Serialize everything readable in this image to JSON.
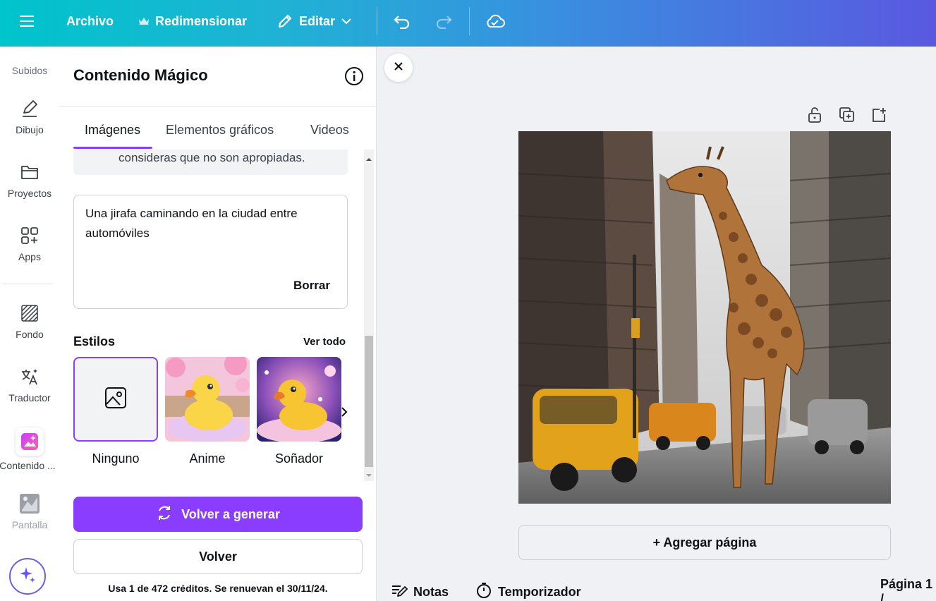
{
  "topbar": {
    "menu_icon": "hamburger-icon",
    "file_label": "Archivo",
    "resize_label": "Redimensionar",
    "resize_icon": "crown-icon",
    "edit_label": "Editar",
    "edit_icon": "pencil-icon",
    "undo_icon": "undo-icon",
    "redo_icon": "redo-icon",
    "save_status_icon": "cloud-check-icon"
  },
  "rail": {
    "items": [
      {
        "label": "Subidos",
        "icon": "upload-icon"
      },
      {
        "label": "Dibujo",
        "icon": "draw-pen-icon"
      },
      {
        "label": "Proyectos",
        "icon": "folder-icon"
      },
      {
        "label": "Apps",
        "icon": "apps-grid-icon"
      },
      {
        "label": "Fondo",
        "icon": "background-stripes-icon"
      },
      {
        "label": "Traductor",
        "icon": "translate-icon"
      },
      {
        "label": "Contenido ...",
        "icon": "magic-media-icon"
      },
      {
        "label": "Pantalla",
        "icon": "screen-icon"
      }
    ],
    "assistant_icon": "sparkle-icon"
  },
  "panel": {
    "title": "Contenido Mágico",
    "tabs": [
      {
        "label": "Imágenes",
        "active": true
      },
      {
        "label": "Elementos gráficos",
        "active": false
      },
      {
        "label": "Videos",
        "active": false
      }
    ],
    "notice_partial": "consideras que no son apropiadas.",
    "prompt": {
      "value": "Una jirafa caminando en la ciudad entre automóviles",
      "clear_label": "Borrar"
    },
    "styles": {
      "title": "Estilos",
      "see_all": "Ver todo",
      "items": [
        {
          "label": "Ninguno",
          "selected": true
        },
        {
          "label": "Anime",
          "selected": false
        },
        {
          "label": "Soñador",
          "selected": false
        }
      ]
    },
    "regenerate_label": "Volver a generar",
    "back_label": "Volver",
    "credits_text": "Usa 1 de 472 créditos. Se renuevan el 30/11/24."
  },
  "canvas": {
    "add_page_label": "+ Agregar página",
    "tools": [
      "unlock-icon",
      "duplicate-page-icon",
      "add-page-icon"
    ]
  },
  "footer": {
    "notes_label": "Notas",
    "timer_label": "Temporizador",
    "page_label": "Página 1 /"
  },
  "colors": {
    "accent": "#8b3dff",
    "topbar_start": "#00c4cc",
    "topbar_end": "#5a58e0"
  }
}
